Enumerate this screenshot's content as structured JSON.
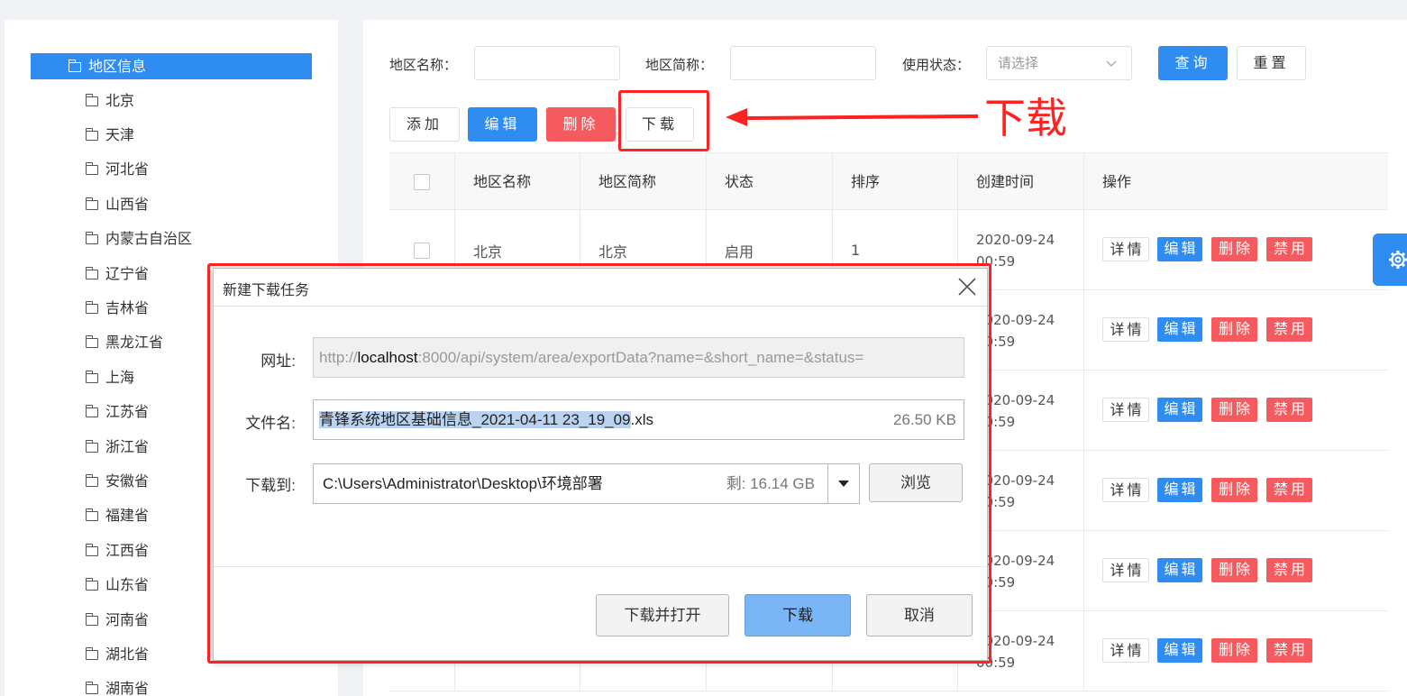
{
  "tree": {
    "root": "地区信息",
    "items": [
      "北京",
      "天津",
      "河北省",
      "山西省",
      "内蒙古自治区",
      "辽宁省",
      "吉林省",
      "黑龙江省",
      "上海",
      "江苏省",
      "浙江省",
      "安徽省",
      "福建省",
      "江西省",
      "山东省",
      "河南省",
      "湖北省",
      "湖南省"
    ]
  },
  "search": {
    "name_label": "地区名称：",
    "short_label": "地区简称：",
    "status_label": "使用状态：",
    "status_placeholder": "请选择",
    "query": "查询",
    "reset": "重置"
  },
  "toolbar": {
    "add": "添加",
    "edit": "编辑",
    "delete": "删除",
    "download": "下载"
  },
  "annotation": "下载",
  "table": {
    "headers": [
      "地区名称",
      "地区简称",
      "状态",
      "排序",
      "创建时间",
      "操作"
    ],
    "rows": [
      {
        "name": "北京",
        "short": "北京",
        "status": "启用",
        "sort": "1",
        "date": "2020-09-24",
        "time": "00:59"
      },
      {
        "date": "2020-09-24",
        "time": "00:59"
      },
      {
        "date": "2020-09-24",
        "time": "00:59"
      },
      {
        "date": "2020-09-24",
        "time": "00:59"
      },
      {
        "date": "2020-09-24",
        "time": "00:59"
      },
      {
        "date": "2020-09-24",
        "time": "00:59"
      }
    ],
    "ops": {
      "detail": "详情",
      "edit": "编辑",
      "delete": "删除",
      "disable": "禁用"
    }
  },
  "dialog": {
    "title": "新建下载任务",
    "url_label": "网址:",
    "url_prefix": "http://",
    "url_host": "localhost",
    "url_rest": ":8000/api/system/area/exportData?name=&short_name=&status=",
    "filename_label": "文件名:",
    "filename_selected": "青锋系统地区基础信息_2021-04-11 23_19_09",
    "filename_ext": ".xls",
    "filesize": "26.50 KB",
    "saveto_label": "下载到:",
    "saveto_path": "C:\\Users\\Administrator\\Desktop\\环境部署",
    "free_space": "剩: 16.14 GB",
    "browse": "浏览",
    "download_open": "下载并打开",
    "download": "下载",
    "cancel": "取消"
  }
}
